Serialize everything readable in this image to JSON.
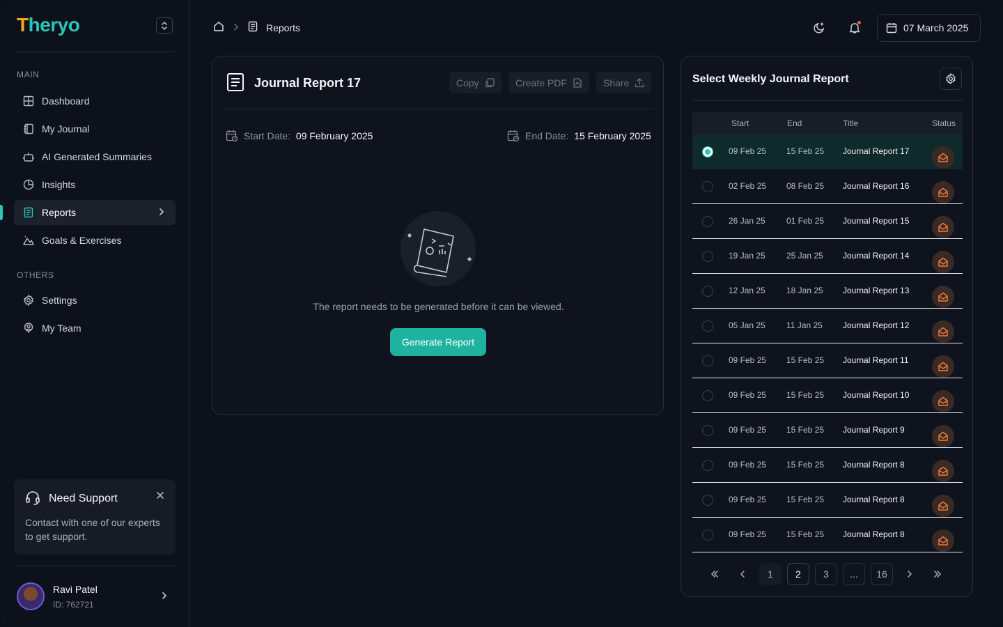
{
  "brand": {
    "logo_first": "T",
    "logo_rest": "heryo"
  },
  "sidebar": {
    "main_label": "MAIN",
    "others_label": "OTHERS",
    "items": [
      {
        "label": "Dashboard",
        "icon": "grid-icon"
      },
      {
        "label": "My Journal",
        "icon": "journal-icon"
      },
      {
        "label": "AI Generated Summaries",
        "icon": "robot-icon"
      },
      {
        "label": "Insights",
        "icon": "pie-chart-icon"
      },
      {
        "label": "Reports",
        "icon": "document-icon",
        "active": true
      },
      {
        "label": "Goals & Exercises",
        "icon": "mountain-icon"
      }
    ],
    "others": [
      {
        "label": "Settings",
        "icon": "gear-icon"
      },
      {
        "label": "My Team",
        "icon": "team-icon"
      }
    ],
    "support": {
      "title": "Need Support",
      "desc": "Contact with one of our experts to get support."
    },
    "user": {
      "name": "Ravi Patel",
      "id": "ID: 762721"
    }
  },
  "header": {
    "breadcrumb": "Reports",
    "date": "07 March 2025"
  },
  "report": {
    "title": "Journal Report 17",
    "copy": "Copy",
    "pdf": "Create PDF",
    "share": "Share",
    "start_label": "Start Date:",
    "start_value": "09 February 2025",
    "end_label": "End Date:",
    "end_value": "15 February 2025",
    "empty_msg": "The report needs to be generated before it can be viewed.",
    "generate": "Generate Report"
  },
  "weekly": {
    "title": "Select Weekly Journal Report",
    "columns": {
      "start": "Start",
      "end": "End",
      "title": "Title",
      "status": "Status"
    },
    "rows": [
      {
        "start": "09 Feb 25",
        "end": "15 Feb 25",
        "title": "Journal Report 17",
        "selected": true
      },
      {
        "start": "02 Feb 25",
        "end": "08 Feb 25",
        "title": "Journal Report 16"
      },
      {
        "start": "26 Jan 25",
        "end": "01 Feb 25",
        "title": "Journal Report 15"
      },
      {
        "start": "19 Jan 25",
        "end": "25 Jan 25",
        "title": "Journal Report 14"
      },
      {
        "start": "12 Jan 25",
        "end": "18 Jan 25",
        "title": "Journal Report 13"
      },
      {
        "start": "05 Jan 25",
        "end": "11 Jan 25",
        "title": "Journal Report 12"
      },
      {
        "start": "09 Feb 25",
        "end": "15 Feb 25",
        "title": "Journal Report 11"
      },
      {
        "start": "09 Feb 25",
        "end": "15 Feb 25",
        "title": "Journal Report 10"
      },
      {
        "start": "09 Feb 25",
        "end": "15 Feb 25",
        "title": "Journal Report 9"
      },
      {
        "start": "09 Feb 25",
        "end": "15 Feb 25",
        "title": "Journal Report 8"
      },
      {
        "start": "09 Feb 25",
        "end": "15 Feb 25",
        "title": "Journal Report 8"
      },
      {
        "start": "09 Feb 25",
        "end": "15 Feb 25",
        "title": "Journal Report 8"
      }
    ],
    "pager": {
      "p1": "1",
      "p2": "2",
      "p3": "3",
      "ellipsis": "...",
      "last": "16",
      "current": "2"
    }
  }
}
